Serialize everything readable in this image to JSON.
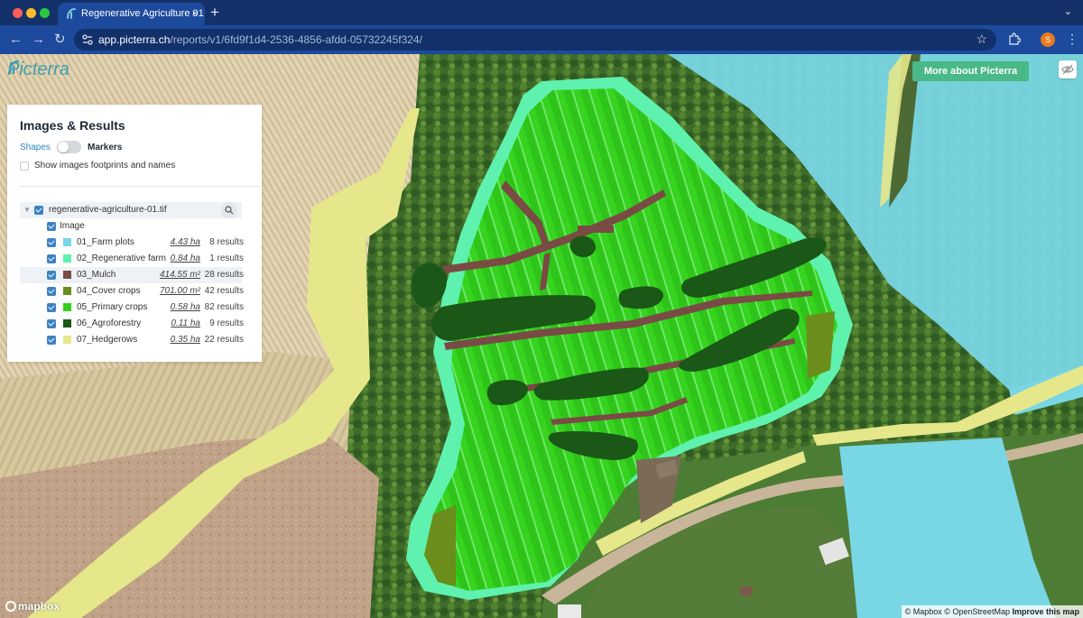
{
  "browser": {
    "tab_title": "Regenerative Agriculture 01",
    "tab_close": "×",
    "new_tab": "+",
    "url_host": "app.picterra.ch",
    "url_path": "/reports/v1/6fd9f1d4-2536-4856-afdd-05732245f324/",
    "profile_initial": "S"
  },
  "app": {
    "logo_text": "Picterra",
    "more_button": "More about Picterra"
  },
  "panel": {
    "title": "Images & Results",
    "mode_shapes": "Shapes",
    "mode_markers": "Markers",
    "toggle_on": false,
    "footprints_label": "Show images footprints and names",
    "file_name": "regenerative-agriculture-01.tif",
    "image_label": "Image",
    "layers": [
      {
        "name": "01_Farm plots",
        "area": "4.43 ha",
        "count": "8 results",
        "color": "#79d6e4"
      },
      {
        "name": "02_Regenerative farm",
        "area": "0.84 ha",
        "count": "1 results",
        "color": "#5ff2ae"
      },
      {
        "name": "03_Mulch",
        "area": "414.55 m²",
        "count": "28 results",
        "color": "#7a4a45"
      },
      {
        "name": "04_Cover crops",
        "area": "701.00 m²",
        "count": "42 results",
        "color": "#6b8e1c"
      },
      {
        "name": "05_Primary crops",
        "area": "0.58 ha",
        "count": "82 results",
        "color": "#33d11d"
      },
      {
        "name": "06_Agroforestry",
        "area": "0.11 ha",
        "count": "9 results",
        "color": "#1b5716"
      },
      {
        "name": "07_Hedgerows",
        "area": "0.35 ha",
        "count": "22 results",
        "color": "#e5e78a"
      }
    ]
  },
  "map": {
    "mapbox_label": "mapbox",
    "attribution_1": "© Mapbox",
    "attribution_2": "© OpenStreetMap",
    "attribution_improve": "Improve this map"
  }
}
